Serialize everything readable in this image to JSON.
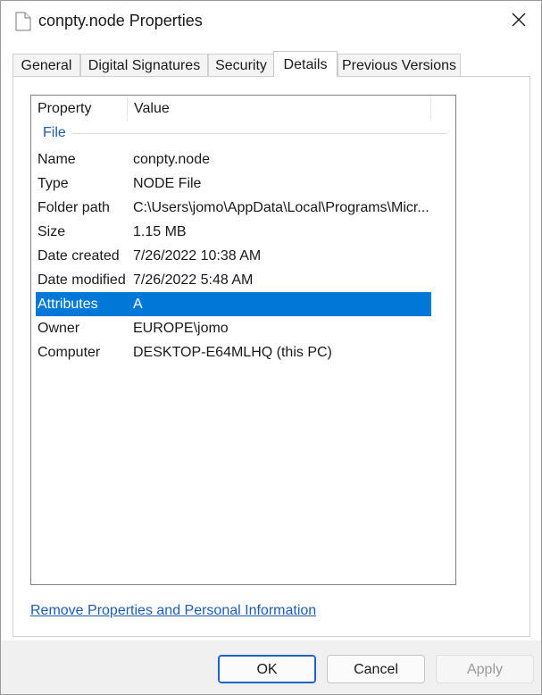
{
  "window": {
    "title": "conpty.node Properties",
    "icon": "document-icon",
    "close_icon": "close-icon"
  },
  "tabs": [
    {
      "label": "General",
      "active": false
    },
    {
      "label": "Digital Signatures",
      "active": false
    },
    {
      "label": "Security",
      "active": false
    },
    {
      "label": "Details",
      "active": true
    },
    {
      "label": "Previous Versions",
      "active": false
    }
  ],
  "details": {
    "columns": {
      "property": "Property",
      "value": "Value"
    },
    "group": "File",
    "rows": [
      {
        "property": "Name",
        "value": "conpty.node"
      },
      {
        "property": "Type",
        "value": "NODE File"
      },
      {
        "property": "Folder path",
        "value": "C:\\Users\\jomo\\AppData\\Local\\Programs\\Micr..."
      },
      {
        "property": "Size",
        "value": "1.15 MB"
      },
      {
        "property": "Date created",
        "value": "7/26/2022 10:38 AM"
      },
      {
        "property": "Date modified",
        "value": "7/26/2022 5:48 AM"
      },
      {
        "property": "Attributes",
        "value": "A"
      },
      {
        "property": "Owner",
        "value": "EUROPE\\jomo"
      },
      {
        "property": "Computer",
        "value": "DESKTOP-E64MLHQ (this PC)"
      }
    ],
    "selected_row": "Attributes"
  },
  "link": {
    "label": "Remove Properties and Personal Information"
  },
  "buttons": {
    "ok": "OK",
    "cancel": "Cancel",
    "apply": "Apply"
  },
  "colors": {
    "selection": "#0078d7",
    "link": "#1f5bb3",
    "group_label": "#1e5aa8",
    "default_button_border": "#1e64c8"
  }
}
